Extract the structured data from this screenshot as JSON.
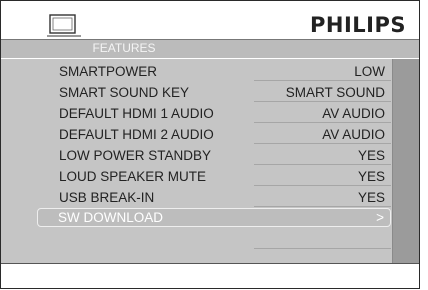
{
  "header": {
    "brand": "PHILIPS",
    "icon": "tv-icon"
  },
  "menu": {
    "title": "FEATURES",
    "items": [
      {
        "label": "SMARTPOWER",
        "value": "LOW"
      },
      {
        "label": "SMART SOUND KEY",
        "value": "SMART SOUND"
      },
      {
        "label": "DEFAULT HDMI 1 AUDIO",
        "value": "AV AUDIO"
      },
      {
        "label": "DEFAULT HDMI 2 AUDIO",
        "value": "AV AUDIO"
      },
      {
        "label": "LOW POWER STANDBY",
        "value": "YES"
      },
      {
        "label": "LOUD SPEAKER MUTE",
        "value": "YES"
      },
      {
        "label": "USB BREAK-IN",
        "value": "YES"
      },
      {
        "label": "SW DOWNLOAD",
        "value": ">",
        "selected": true
      }
    ]
  },
  "colors": {
    "content_bg": "#c5c5c5",
    "scroll_bg": "#9b9b9b",
    "selected_text": "#ffffff"
  }
}
